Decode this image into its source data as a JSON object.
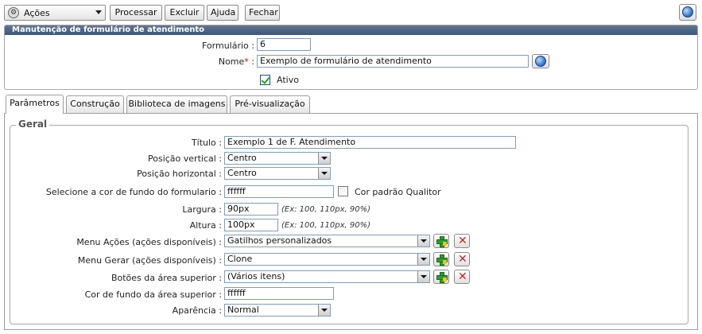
{
  "toolbar": {
    "actions_label": "Ações",
    "buttons": [
      "Processar",
      "Excluir",
      "Ajuda",
      "Fechar"
    ]
  },
  "header_panel": {
    "title": "Manutenção de formulário de atendimento",
    "formulario_label": "Formulário :",
    "formulario_value": "6",
    "nome_label": "Nome",
    "required_mark": "*",
    "nome_suffix": " :",
    "nome_value": "Exemplo de formulário de atendimento",
    "ativo_label": "Ativo",
    "ativo_checked": true
  },
  "tabs": [
    "Parâmetros",
    "Construção",
    "Biblioteca de imagens",
    "Pré-visualização"
  ],
  "active_tab": "Parâmetros",
  "geral": {
    "legend": "Geral",
    "titulo_label": "Título :",
    "titulo_value": "Exemplo 1 de F. Atendimento",
    "posicao_vertical_label": "Posição vertical :",
    "posicao_vertical_value": "Centro",
    "posicao_horizontal_label": "Posição horizontal :",
    "posicao_horizontal_value": "Centro",
    "cor_fundo_label": "Selecione a cor de fundo do formulario :",
    "cor_fundo_value": "ffffff",
    "cor_padrao_label": "Cor padrão Qualitor",
    "largura_label": "Largura :",
    "largura_value": "90px",
    "largura_hint": "(Ex: 100, 110px, 90%)",
    "altura_label": "Altura :",
    "altura_value": "100px",
    "altura_hint": "(Ex: 100, 110px, 90%)",
    "menu_acoes_label": "Menu Ações (ações disponíveis) :",
    "menu_acoes_value": "Gatilhos personalizados",
    "menu_gerar_label": "Menu Gerar (ações disponíveis) :",
    "menu_gerar_value": "Clone",
    "botoes_label": "Botões da área superior :",
    "botoes_value": "(Vários itens)",
    "cor_area_label": "Cor de fundo da área superior :",
    "cor_area_value": "ffffff",
    "aparencia_label": "Aparência :",
    "aparencia_value": "Normal"
  },
  "colors": {
    "panel_header": "#4f6685",
    "required": "#d00000",
    "add_icon": "#2f9a2f",
    "delete_icon": "#d42020"
  }
}
